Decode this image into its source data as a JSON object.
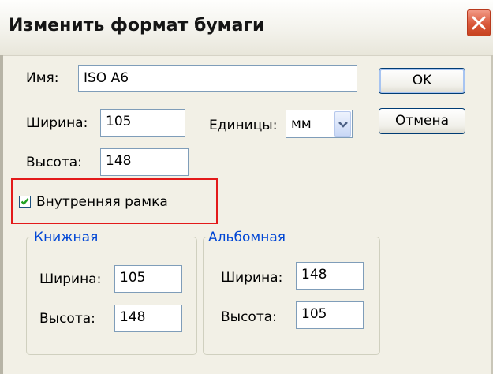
{
  "dialog": {
    "title": "Изменить формат бумаги"
  },
  "form": {
    "name_label": "Имя:",
    "name_value": "ISO A6",
    "width_label": "Ширина:",
    "width_value": "105",
    "height_label": "Высота:",
    "height_value": "148",
    "units_label": "Единицы:",
    "units_value": "мм"
  },
  "buttons": {
    "ok_label": "OK",
    "cancel_label": "Отмена"
  },
  "inner_frame": {
    "label": "Внутренняя рамка",
    "checked": true
  },
  "portrait": {
    "title": "Книжная",
    "width_label": "Ширина:",
    "width_value": "105",
    "height_label": "Высота:",
    "height_value": "148"
  },
  "landscape": {
    "title": "Альбомная",
    "width_label": "Ширина:",
    "width_value": "148",
    "height_label": "Высота:",
    "height_value": "105"
  },
  "colors": {
    "highlight_border": "#e31a1a",
    "group_title": "#0046d5",
    "close_button": "#d9573a",
    "dialog_background": "#f2f0e6"
  },
  "icons": {
    "close": "close-icon",
    "dropdown": "chevron-down-icon",
    "check": "checkmark-icon"
  }
}
